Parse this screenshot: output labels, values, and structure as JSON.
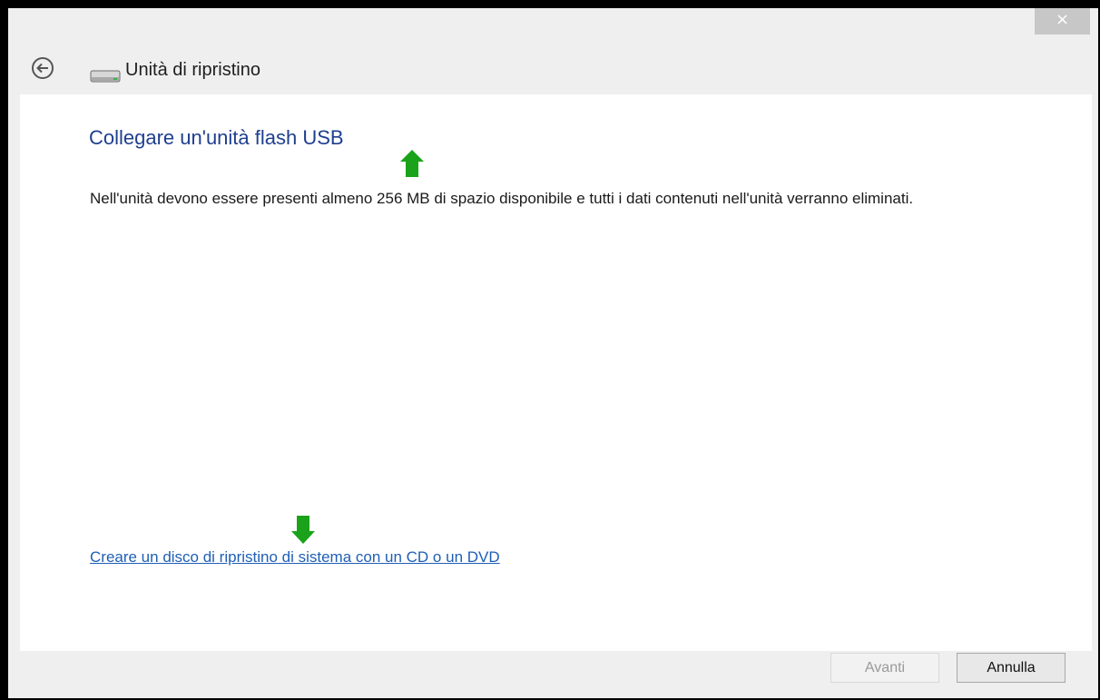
{
  "window": {
    "title": "Unità di ripristino",
    "close_label": "×"
  },
  "main": {
    "heading": "Collegare un'unità flash USB",
    "description": "Nell'unità devono essere presenti almeno 256 MB di spazio disponibile e tutti i dati contenuti nell'unità verranno eliminati.",
    "cd_dvd_link": "Creare un disco di ripristino di sistema con un CD o un DVD"
  },
  "footer": {
    "next_label": "Avanti",
    "cancel_label": "Annulla"
  },
  "icons": {
    "back": "back-arrow-circle-icon",
    "drive": "drive-icon",
    "annotation_arrow_color": "#1aa31a"
  }
}
